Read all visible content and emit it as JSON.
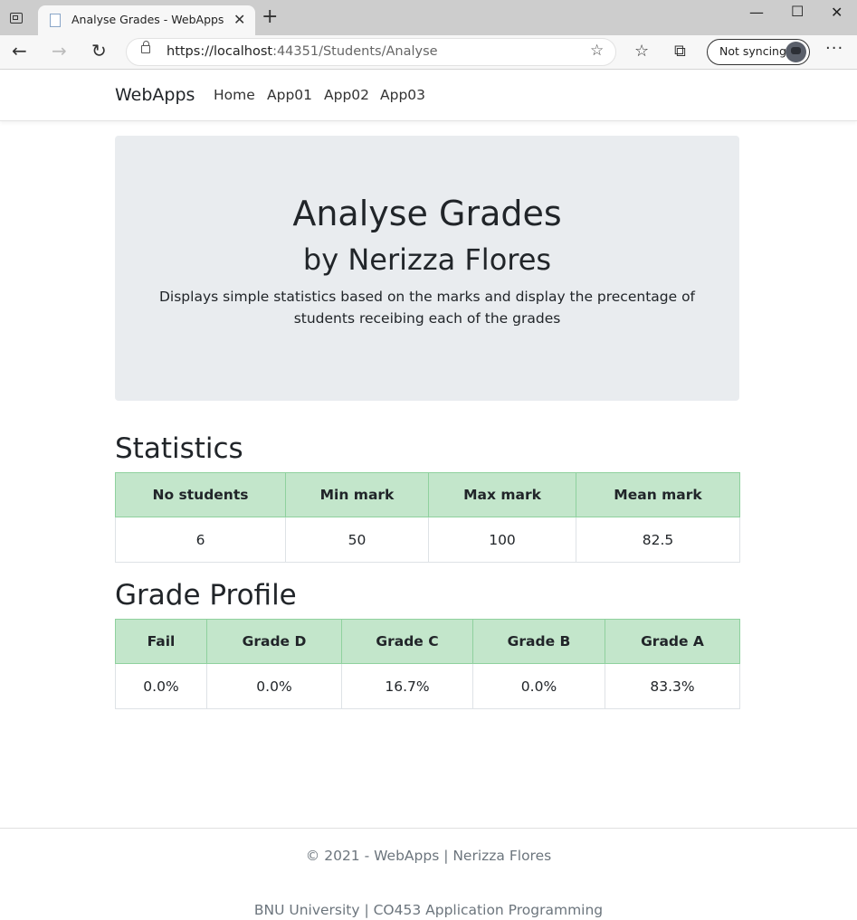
{
  "browser": {
    "tab_title": "Analyse Grades - WebApps",
    "url_host": "https://localhost",
    "url_rest": ":44351/Students/Analyse",
    "sync_label": "Not syncing"
  },
  "navbar": {
    "brand": "WebApps",
    "links": [
      "Home",
      "App01",
      "App02",
      "App03"
    ]
  },
  "jumbotron": {
    "title": "Analyse Grades",
    "subtitle": "by Nerizza Flores",
    "description": "Displays simple statistics based on the marks and display the precentage of students receibing each of the grades"
  },
  "statistics": {
    "heading": "Statistics",
    "headers": [
      "No students",
      "Min mark",
      "Max mark",
      "Mean mark"
    ],
    "values": [
      "6",
      "50",
      "100",
      "82.5"
    ]
  },
  "grade_profile": {
    "heading": "Grade Profile",
    "headers": [
      "Fail",
      "Grade D",
      "Grade C",
      "Grade B",
      "Grade A"
    ],
    "values": [
      "0.0%",
      "0.0%",
      "16.7%",
      "0.0%",
      "83.3%"
    ]
  },
  "footer": {
    "line1": "© 2021 - WebApps | Nerizza Flores",
    "line2": "BNU University | CO453 Application Programming"
  },
  "colors": {
    "table_header_bg": "#c3e6cb",
    "jumbotron_bg": "#e9ecef"
  }
}
